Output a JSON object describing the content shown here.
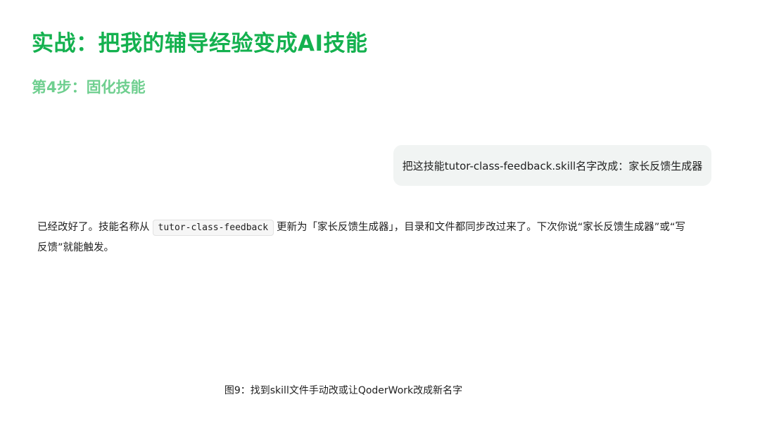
{
  "page": {
    "title": "实战：把我的辅导经验变成AI技能",
    "subtitle": "第4步：固化技能"
  },
  "chat": {
    "user_message": "把这技能tutor-class-feedback.skill名字改成：家长反馈生成器",
    "assistant_reply": {
      "prefix": "已经改好了。技能名称从",
      "code": "tutor-class-feedback",
      "suffix": "更新为「家长反馈生成器」，目录和文件都同步改过来了。下次你说“家长反馈生成器”或“写反馈”就能触发。"
    }
  },
  "caption": "图9：找到skill文件手动改或让QoderWork改成新名字",
  "colors": {
    "title": "#14b14f",
    "subtitle": "#6fcf8f",
    "user_bubble_bg": "#f1f4f3",
    "code_bg": "#f6f6f6"
  }
}
